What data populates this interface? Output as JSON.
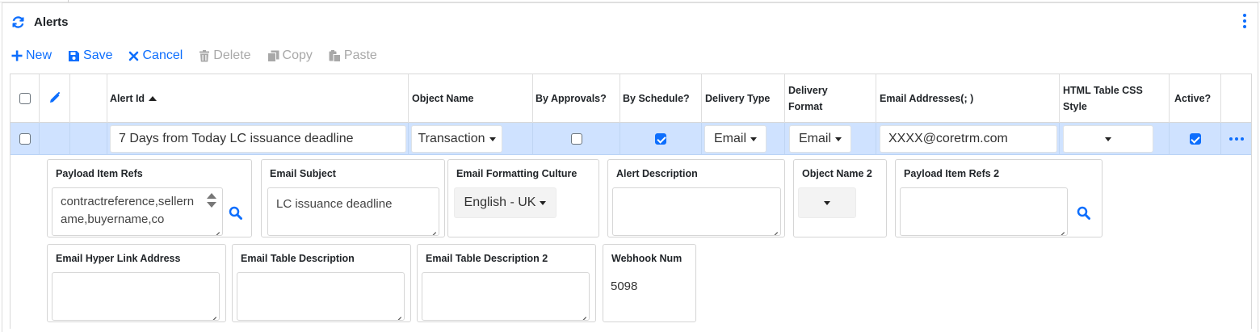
{
  "header": {
    "title": "Alerts",
    "refresh_icon": "refresh-icon",
    "menu_icon": "kebab-menu-icon"
  },
  "toolbar": {
    "new": "New",
    "save": "Save",
    "cancel": "Cancel",
    "delete": "Delete",
    "copy": "Copy",
    "paste": "Paste"
  },
  "grid": {
    "columns": {
      "alert_id": "Alert Id",
      "object_name": "Object Name",
      "by_approvals": "By Approvals?",
      "by_schedule": "By Schedule?",
      "delivery_type": "Delivery Type",
      "delivery_format_1": "Delivery",
      "delivery_format_2": "Format",
      "email_addresses": "Email Addresses(; )",
      "html_css_1": "HTML Table CSS",
      "html_css_2": "Style",
      "active": "Active?"
    },
    "row": {
      "alert_id": "7 Days from Today LC issuance deadline",
      "object_name": "Transaction",
      "by_approvals": false,
      "by_schedule": true,
      "delivery_type": "Email",
      "delivery_format": "Email",
      "email_addresses": "XXXX@coretrm.com",
      "html_css_style": "",
      "active": true
    }
  },
  "detail": {
    "payload_item_refs": {
      "label": "Payload Item Refs",
      "value": "contractreference,sellername,buyername,co"
    },
    "email_subject": {
      "label": "Email Subject",
      "value": "LC issuance deadline"
    },
    "email_formatting_culture": {
      "label": "Email Formatting Culture",
      "value": "English - UK"
    },
    "alert_description": {
      "label": "Alert Description",
      "value": ""
    },
    "object_name_2": {
      "label": "Object Name 2",
      "value": ""
    },
    "payload_item_refs_2": {
      "label": "Payload Item Refs 2",
      "value": ""
    },
    "email_hyper_link_address": {
      "label": "Email Hyper Link Address",
      "value": ""
    },
    "email_table_description": {
      "label": "Email Table Description",
      "value": ""
    },
    "email_table_description_2": {
      "label": "Email Table Description 2",
      "value": ""
    },
    "webhook_num": {
      "label": "Webhook Num",
      "value": "5098"
    }
  },
  "colors": {
    "accent": "#0d6efd",
    "row_selected": "#cfe2ff",
    "disabled": "#a8a8a8"
  }
}
